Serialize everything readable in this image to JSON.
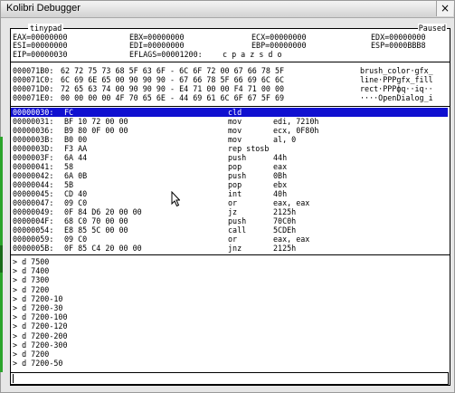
{
  "window": {
    "title": "Kolibri Debugger",
    "close_label": "×"
  },
  "registers": {
    "panel_title": "tinypad",
    "status": "Paused",
    "eax": "EAX=00000000",
    "ebx": "EBX=00000000",
    "ecx": "ECX=00000000",
    "edx": "EDX=00000000",
    "esi": "ESI=00000000",
    "edi": "EDI=00000000",
    "ebp": "EBP=00000000",
    "esp": "ESP=0000BBB8",
    "eip": "EIP=00000030",
    "eflags": "EFLAGS=00001200:",
    "flags": "c p a z s d o"
  },
  "hex_dump": [
    {
      "addr": "000071B0:",
      "bytes": "62 72 75 73 68 5F 63 6F - 6C 6F 72 00 67 66 78 5F",
      "ascii": "brush_color·gfx_"
    },
    {
      "addr": "000071C0:",
      "bytes": "6C 69 6E 65 00 90 90 90 - 67 66 78 5F 66 69 6C 6C",
      "ascii": "line·PPPgfx_fill"
    },
    {
      "addr": "000071D0:",
      "bytes": "72 65 63 74 00 90 90 90 - E4 71 00 00 F4 71 00 00",
      "ascii": "rect·PPPфq··iq··"
    },
    {
      "addr": "000071E0:",
      "bytes": "00 00 00 00 4F 70 65 6E - 44 69 61 6C 6F 67 5F 69",
      "ascii": "····OpenDialog_i"
    }
  ],
  "disassembly": [
    {
      "addr": "00000030:",
      "bytes": "FC",
      "mnem": "cld",
      "ops": ""
    },
    {
      "addr": "00000031:",
      "bytes": "BF 10 72 00 00",
      "mnem": "mov",
      "ops": "edi, 7210h"
    },
    {
      "addr": "00000036:",
      "bytes": "B9 80 0F 00 00",
      "mnem": "mov",
      "ops": "ecx, 0F80h"
    },
    {
      "addr": "0000003B:",
      "bytes": "B0 00",
      "mnem": "mov",
      "ops": "al, 0"
    },
    {
      "addr": "0000003D:",
      "bytes": "F3 AA",
      "mnem": "rep stosb",
      "ops": ""
    },
    {
      "addr": "0000003F:",
      "bytes": "6A 44",
      "mnem": "push",
      "ops": "44h"
    },
    {
      "addr": "00000041:",
      "bytes": "58",
      "mnem": "pop",
      "ops": "eax"
    },
    {
      "addr": "00000042:",
      "bytes": "6A 0B",
      "mnem": "push",
      "ops": "0Bh"
    },
    {
      "addr": "00000044:",
      "bytes": "5B",
      "mnem": "pop",
      "ops": "ebx"
    },
    {
      "addr": "00000045:",
      "bytes": "CD 40",
      "mnem": "int",
      "ops": "40h"
    },
    {
      "addr": "00000047:",
      "bytes": "09 C0",
      "mnem": "or",
      "ops": "eax, eax"
    },
    {
      "addr": "00000049:",
      "bytes": "0F 84 D6 20 00 00",
      "mnem": "jz",
      "ops": "2125h"
    },
    {
      "addr": "0000004F:",
      "bytes": "68 C0 70 00 00",
      "mnem": "push",
      "ops": "70C0h"
    },
    {
      "addr": "00000054:",
      "bytes": "E8 85 5C 00 00",
      "mnem": "call",
      "ops": "5CDEh"
    },
    {
      "addr": "00000059:",
      "bytes": "09 C0",
      "mnem": "or",
      "ops": "eax, eax"
    },
    {
      "addr": "0000005B:",
      "bytes": "0F 85 C4 20 00 00",
      "mnem": "jnz",
      "ops": "2125h"
    }
  ],
  "console": [
    "> d 7500",
    "> d 7400",
    "> d 7300",
    "> d 7200",
    "> d 7200-10",
    "> d 7200-30",
    "> d 7200-100",
    "> d 7200-120",
    "> d 7200-200",
    "> d 7200-300",
    "> d 7200",
    "> d 7200-50"
  ],
  "command_input": {
    "value": ""
  }
}
